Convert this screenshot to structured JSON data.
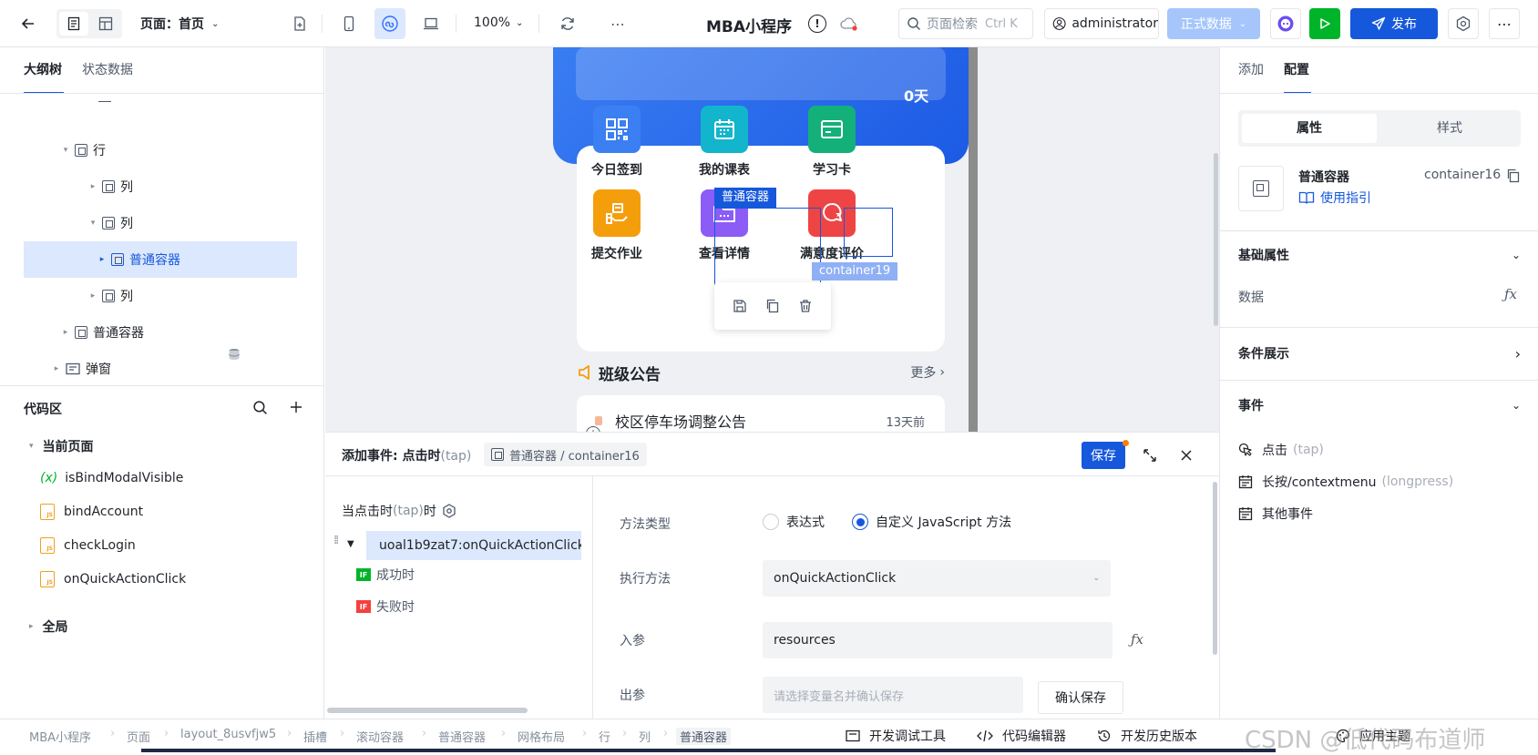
{
  "topbar": {
    "page_label": "页面：首页",
    "zoom": "100%",
    "app_title": "MBA小程序",
    "search_placeholder": "页面检索",
    "search_shortcut": "Ctrl K",
    "user": "administrator",
    "env": "正式数据",
    "publish": "发布"
  },
  "left": {
    "tabs": [
      "大纲树",
      "状态数据"
    ],
    "tree": [
      {
        "label": "行",
        "depth": 2,
        "caret": "▾"
      },
      {
        "label": "列",
        "depth": 3,
        "caret": "▸"
      },
      {
        "label": "列",
        "depth": 3,
        "caret": "▾"
      },
      {
        "label": "普通容器",
        "depth": 4,
        "caret": "▸",
        "selected": true
      },
      {
        "label": "列",
        "depth": 3,
        "caret": "▸"
      },
      {
        "label": "普通容器",
        "depth": 1,
        "caret": "▸"
      },
      {
        "label": "弹窗",
        "depth": 0,
        "caret": "▸"
      }
    ],
    "code_title": "代码区",
    "code_current": "当前页面",
    "code_items": [
      {
        "label": "isBindModalVisible",
        "kind": "var"
      },
      {
        "label": "bindAccount",
        "kind": "js"
      },
      {
        "label": "checkLogin",
        "kind": "js"
      },
      {
        "label": "onQuickActionClick",
        "kind": "js"
      }
    ],
    "code_global": "全局"
  },
  "canvas": {
    "hero_text": "0天",
    "grid": [
      {
        "label": "今日签到",
        "color": "#3b7ff3"
      },
      {
        "label": "我的课表",
        "color": "#12b5cb"
      },
      {
        "label": "学习卡",
        "color": "#14b07a"
      },
      {
        "label": "提交作业",
        "color": "#f59e0b"
      },
      {
        "label": "查看详情",
        "color": "#8b5cf6"
      },
      {
        "label": "满意度评价",
        "color": "#ef4444"
      }
    ],
    "selected_tag": "普通容器",
    "hover_tag": "container19",
    "notice_title": "班级公告",
    "notice_more": "更多",
    "notice_item": "校区停车场调整公告",
    "notice_time": "13天前"
  },
  "event": {
    "title": "添加事件: 点击时",
    "title_sub": "(tap)",
    "crumb": "普通容器 / container16",
    "save": "保存",
    "when_label": "当点击时",
    "when_sub": "(tap)",
    "when_suffix": "时",
    "action": "uoal1b9zat7:onQuickActionClick",
    "success": "成功时",
    "fail": "失败时",
    "method_type_label": "方法类型",
    "method_opt1": "表达式",
    "method_opt2": "自定义 JavaScript 方法",
    "exec_label": "执行方法",
    "exec_value": "onQuickActionClick",
    "param_label": "入参",
    "param_value": "resources",
    "out_label": "出参",
    "out_placeholder": "请选择变量名并确认保存",
    "confirm": "确认保存"
  },
  "right": {
    "tabs": [
      "添加",
      "配置"
    ],
    "seg": [
      "属性",
      "样式"
    ],
    "comp_name": "普通容器",
    "comp_id": "container16",
    "guide": "使用指引",
    "basic": "基础属性",
    "data_label": "数据",
    "cond": "条件展示",
    "events": "事件",
    "event_items": [
      {
        "label": "点击",
        "sub": "(tap)"
      },
      {
        "label": "长按/contextmenu",
        "sub": "(longpress)"
      },
      {
        "label": "其他事件",
        "sub": ""
      }
    ]
  },
  "status": {
    "crumbs": [
      "MBA小程序",
      "页面",
      "layout_8usvfjw5",
      "插槽",
      "滚动容器",
      "普通容器",
      "网格布局",
      "行",
      "列",
      "普通容器"
    ],
    "tools": [
      "开发调试工具",
      "代码编辑器",
      "开发历史版本",
      "应用主题"
    ],
    "watermark": "CSDN @低代码布道师"
  }
}
